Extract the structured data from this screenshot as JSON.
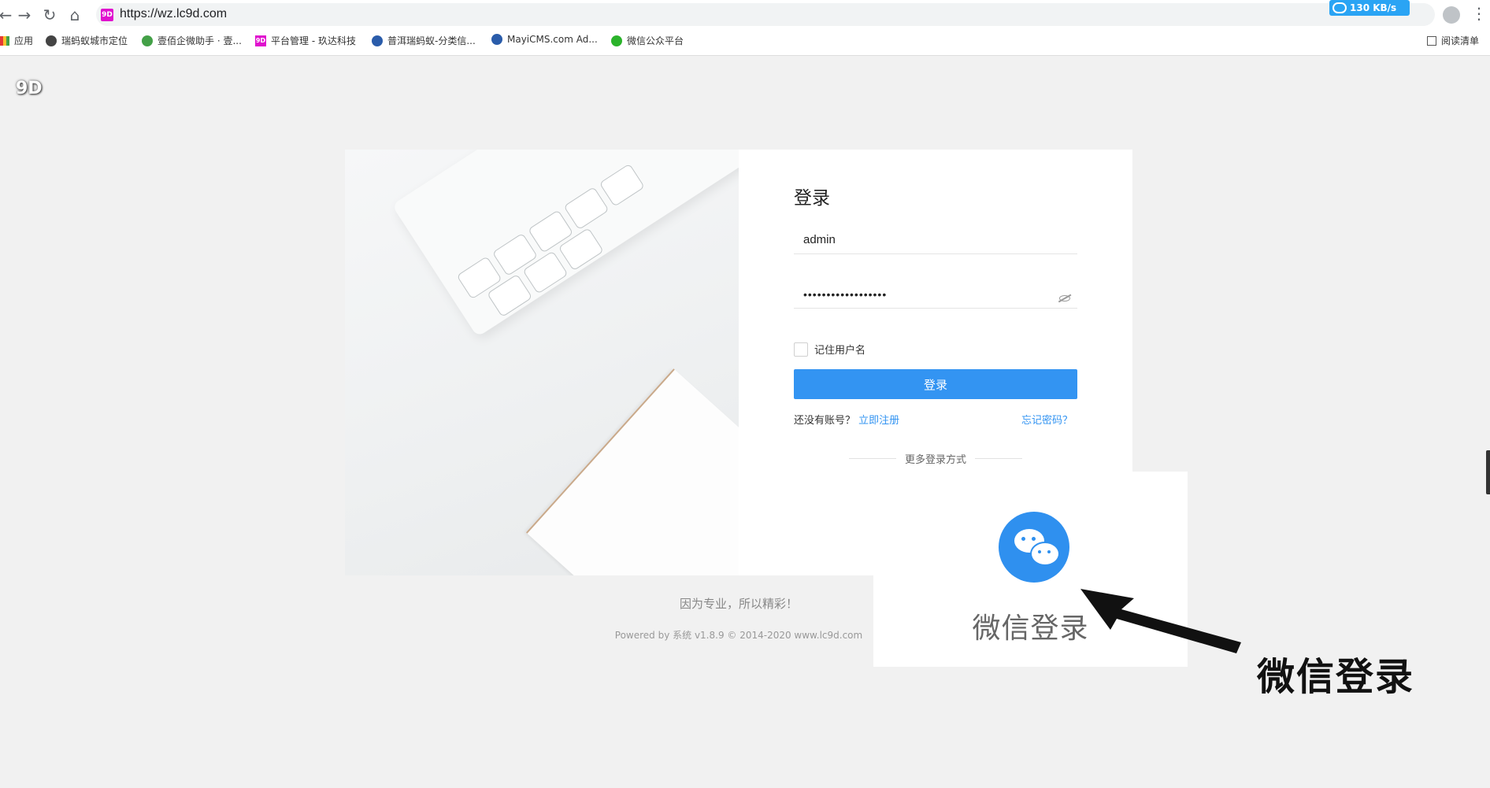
{
  "browser": {
    "url": "https://wz.lc9d.com",
    "site_icon": "9D",
    "speed": "130 KB/s",
    "menu_label": "⋮",
    "bookmarks": [
      {
        "label": "应用"
      },
      {
        "label": "瑞蚂蚁城市定位"
      },
      {
        "label": "壹佰企微助手 · 壹..."
      },
      {
        "label": "平台管理 - 玖达科技"
      },
      {
        "label": "普洱瑞蚂蚁-分类信..."
      },
      {
        "label": "MayiCMS.com Ad..."
      },
      {
        "label": "微信公众平台"
      }
    ],
    "reading_list": "阅读清单"
  },
  "page": {
    "logo": "9D",
    "login": {
      "title": "登录",
      "username_value": "admin",
      "password_value": "••••••••••••••••••",
      "remember_label": "记住用户名",
      "login_button": "登录",
      "no_account_text": "还没有账号？",
      "register_link": "立即注册",
      "forgot_link": "忘记密码？",
      "more_login": "更多登录方式"
    },
    "slogan": "因为专业，所以精彩！",
    "copyright": "Powered by 系统 v1.8.9 © 2014-2020 www.lc9d.com"
  },
  "annotation": {
    "callout_label": "微信登录",
    "arrow_label": "微信登录",
    "wechat_color": "#2f90ef"
  },
  "colors": {
    "accent": "#3394f2",
    "background": "#f1f1f1"
  }
}
